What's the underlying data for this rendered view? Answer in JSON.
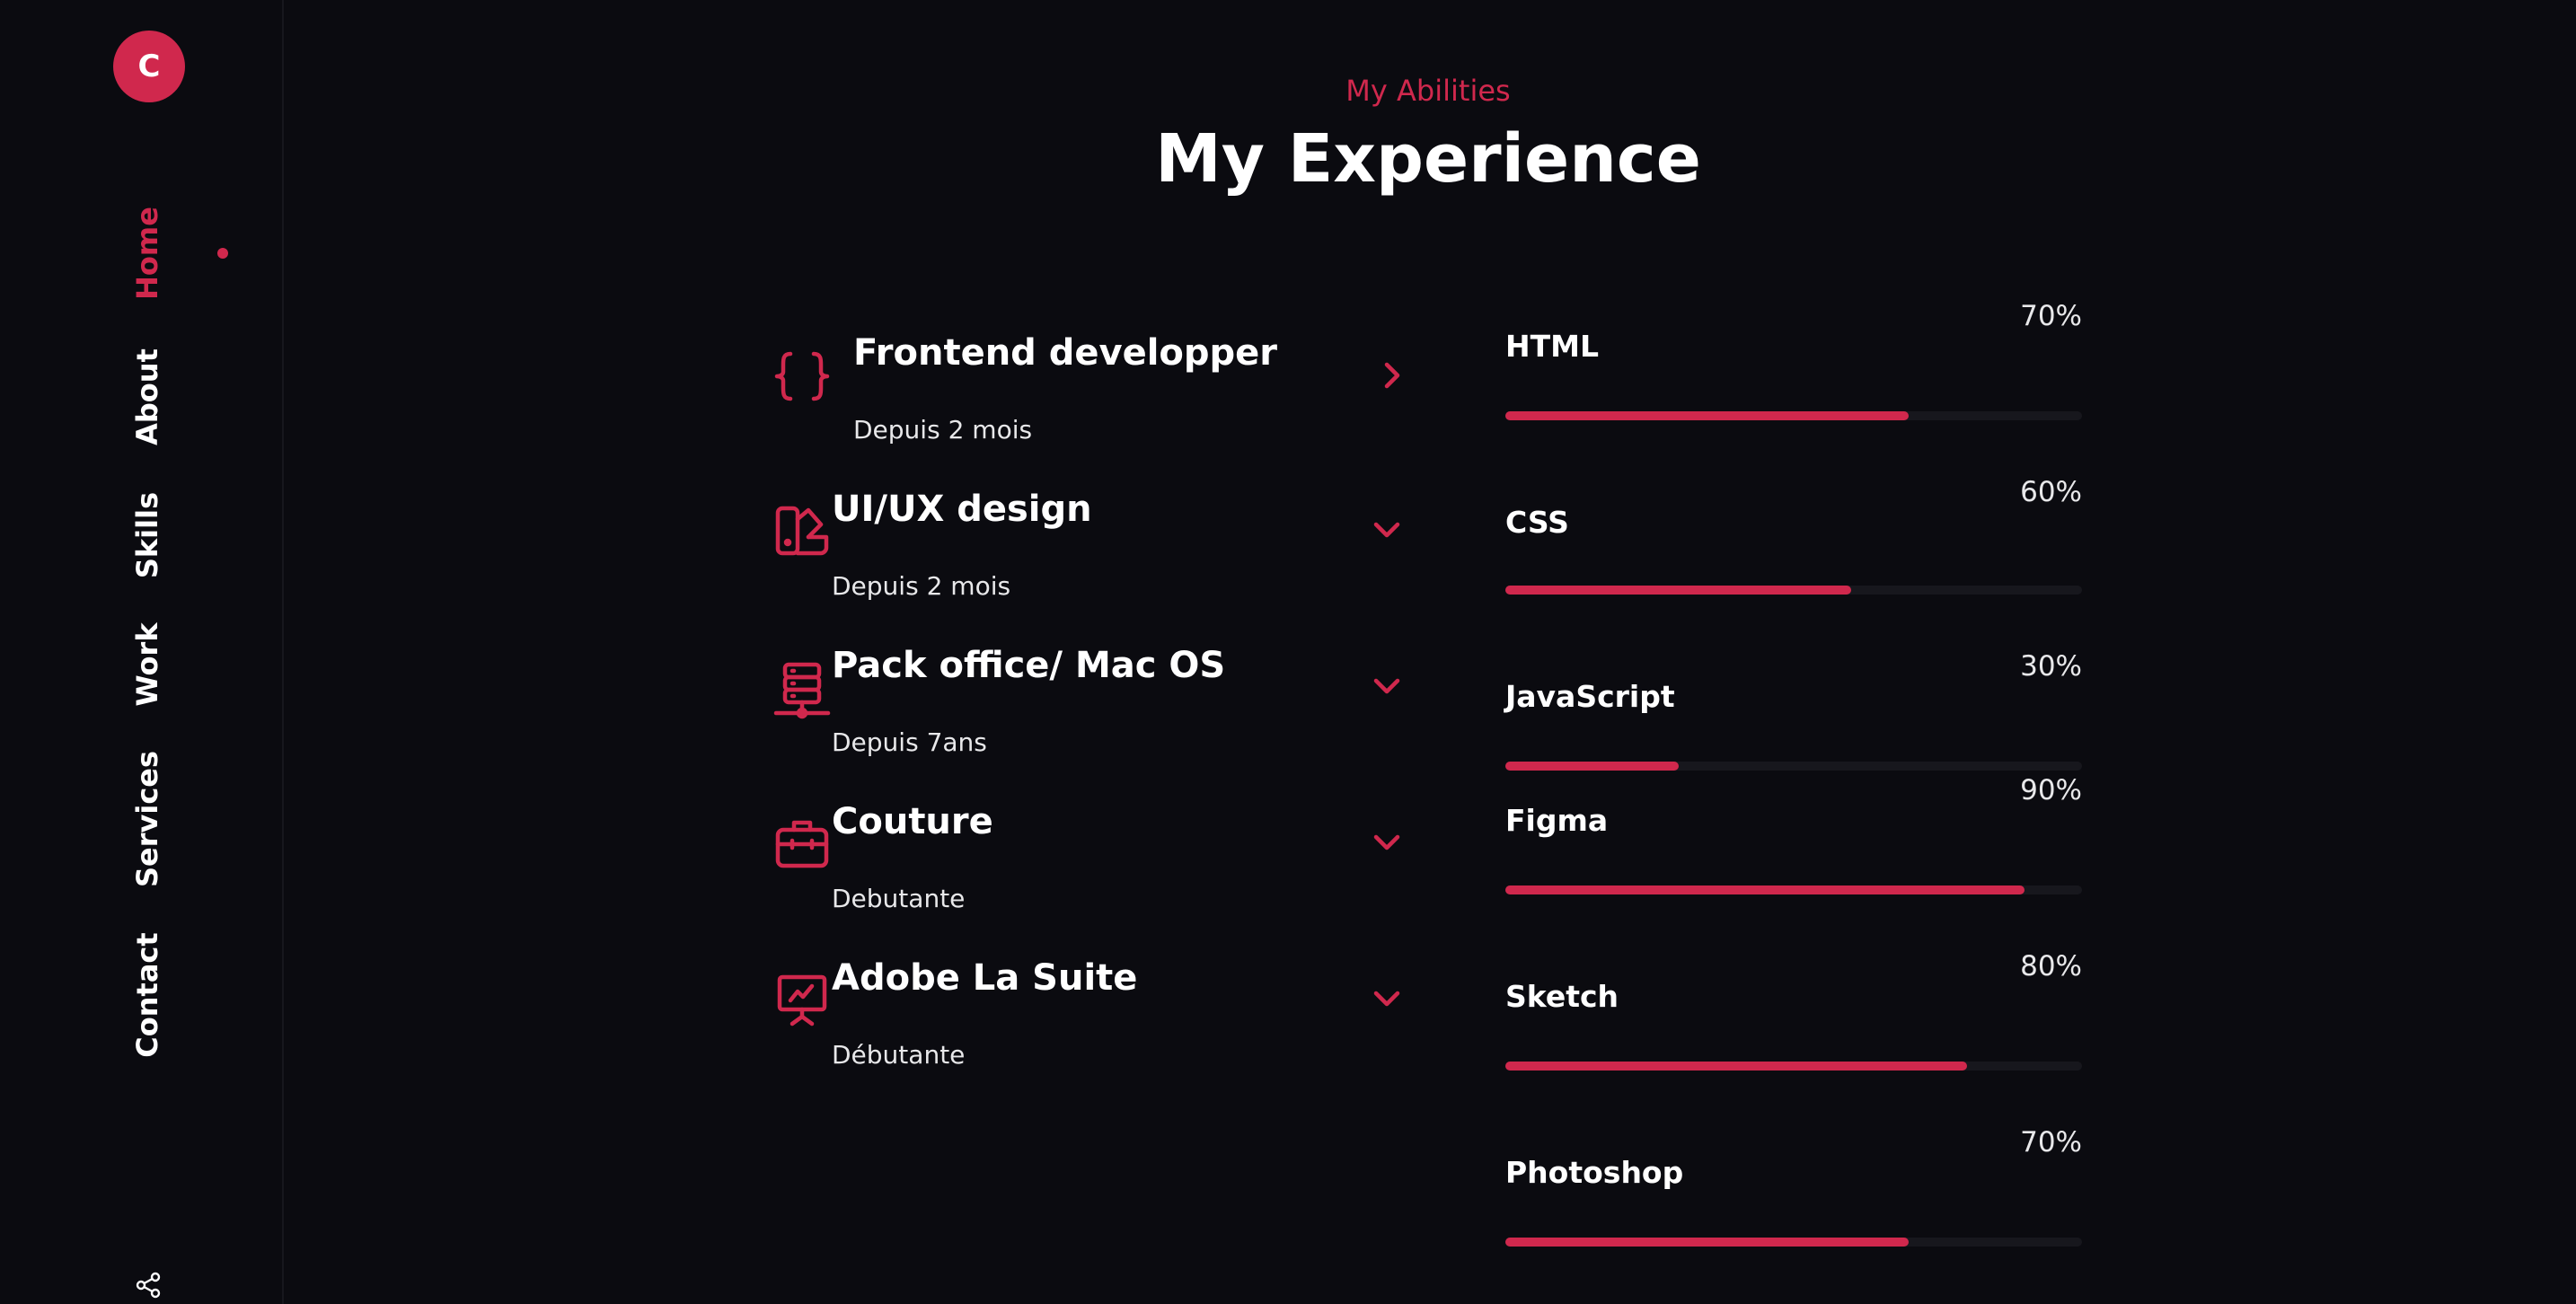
{
  "brand": {
    "logo_letter": "C",
    "accent": "#d0284d",
    "background": "#0b0b10"
  },
  "nav": {
    "items": [
      {
        "label": "Home",
        "active": true
      },
      {
        "label": "About",
        "active": false
      },
      {
        "label": "Skills",
        "active": false
      },
      {
        "label": "Work",
        "active": false
      },
      {
        "label": "Services",
        "active": false
      },
      {
        "label": "Contact",
        "active": false
      }
    ],
    "share_icon": "share-icon"
  },
  "header": {
    "eyebrow": "My Abilities",
    "title": "My Experience"
  },
  "experience": [
    {
      "title": "Frontend developper",
      "subtitle": "Depuis 2 mois",
      "icon": "braces-icon",
      "chevron": "chevron-right-icon"
    },
    {
      "title": "UI/UX design",
      "subtitle": "Depuis 2 mois",
      "icon": "swatchbook-icon",
      "chevron": "chevron-down-icon"
    },
    {
      "title": "Pack office/ Mac OS",
      "subtitle": "Depuis 7ans",
      "icon": "server-icon",
      "chevron": "chevron-down-icon"
    },
    {
      "title": "Couture",
      "subtitle": "Debutante",
      "icon": "briefcase-icon",
      "chevron": "chevron-down-icon"
    },
    {
      "title": "Adobe La Suite",
      "subtitle": "Débutante",
      "icon": "presentation-icon",
      "chevron": "chevron-down-icon"
    }
  ],
  "skills": [
    {
      "name": "HTML",
      "percent_label": "70%",
      "level": 0.7
    },
    {
      "name": "CSS",
      "percent_label": "60%",
      "level": 0.6
    },
    {
      "name": "JavaScript",
      "percent_label": "30%",
      "level": 0.3
    },
    {
      "name": "Figma",
      "percent_label": "90%",
      "level": 0.9
    },
    {
      "name": "Sketch",
      "percent_label": "80%",
      "level": 0.8
    },
    {
      "name": "Photoshop",
      "percent_label": "70%",
      "level": 0.7
    }
  ]
}
